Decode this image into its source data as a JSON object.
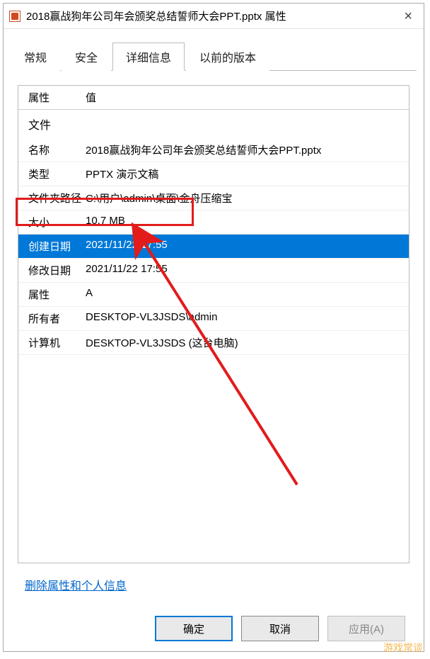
{
  "titlebar": {
    "title": "2018赢战狗年公司年会颁奖总结誓师大会PPT.pptx 属性"
  },
  "tabs": {
    "general": "常规",
    "security": "安全",
    "details": "详细信息",
    "previous": "以前的版本"
  },
  "headers": {
    "property": "属性",
    "value": "值"
  },
  "section": "文件",
  "rows": {
    "name": {
      "label": "名称",
      "value": "2018赢战狗年公司年会颁奖总结誓师大会PPT.pptx"
    },
    "type": {
      "label": "类型",
      "value": "PPTX 演示文稿"
    },
    "folder": {
      "label": "文件夹路径",
      "value": "C:\\用户\\admin\\桌面\\金舟压缩宝"
    },
    "size": {
      "label": "大小",
      "value": "10.7 MB"
    },
    "created": {
      "label": "创建日期",
      "value": "2021/11/22 17:55"
    },
    "modified": {
      "label": "修改日期",
      "value": "2021/11/22 17:55"
    },
    "attributes": {
      "label": "属性",
      "value": "A"
    },
    "owner": {
      "label": "所有者",
      "value": "DESKTOP-VL3JSDS\\admin"
    },
    "computer": {
      "label": "计算机",
      "value": "DESKTOP-VL3JSDS (这台电脑)"
    }
  },
  "link": "删除属性和个人信息",
  "buttons": {
    "ok": "确定",
    "cancel": "取消",
    "apply": "应用(A)"
  },
  "watermark": "游戏常谈"
}
